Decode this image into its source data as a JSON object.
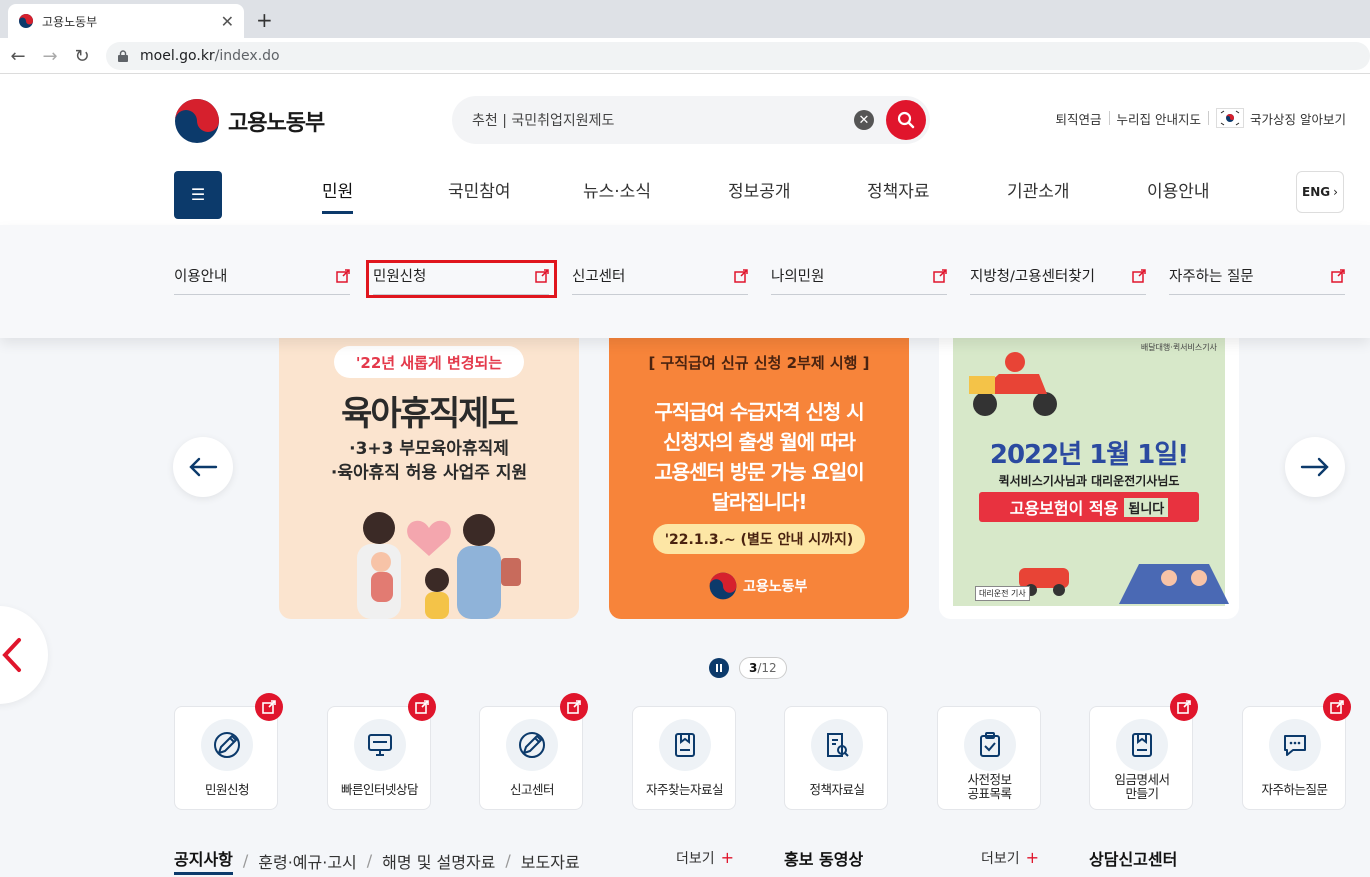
{
  "browser": {
    "tab_title": "고용노동부",
    "url_domain": "moel.go.kr",
    "url_path": "/index.do"
  },
  "header": {
    "logo_text": "고용노동부",
    "search_value": "추천 | 국민취업지원제도",
    "utils": [
      "퇴직연금",
      "누리집 안내지도",
      "국가상징 알아보기"
    ],
    "lang_label": "ENG"
  },
  "gnb": [
    "민원",
    "국민참여",
    "뉴스·소식",
    "정보공개",
    "정책자료",
    "기관소개",
    "이용안내"
  ],
  "submenu": [
    "이용안내",
    "민원신청",
    "신고센터",
    "나의민원",
    "지방청/고용센터찾기",
    "자주하는 질문"
  ],
  "carousel": {
    "card1": {
      "pill": "'22년 새롭게 변경되는",
      "title": "육아휴직제도",
      "line1": "·3+3 부모육아휴직제",
      "line2": "·육아휴직 허용 사업주 지원"
    },
    "card2": {
      "top": "[ 구직급여 신규 신청 2부제 시행 ]",
      "line1": "구직급여 수급자격 신청 시",
      "line2": "신청자의 출생 월에 따라",
      "line3": "고용센터 방문 가능 요일이",
      "line4": "달라집니다!",
      "date": "'22.1.3.~ (별도 안내 시까지)",
      "brand": "고용노동부"
    },
    "card3": {
      "tag": "배달대행·퀵서비스기사",
      "headline": "2022년 1월 1일!",
      "sub": "퀵서비스기사님과 대리운전기사님도",
      "banner": "고용보험이 적용",
      "banner_suffix": "됩니다",
      "label": "대리운전 기사"
    },
    "pager_current": "3",
    "pager_total": "/12"
  },
  "quick_links": [
    {
      "label": "민원신청",
      "badge": true
    },
    {
      "label": "빠른인터넷상담",
      "badge": true
    },
    {
      "label": "신고센터",
      "badge": true
    },
    {
      "label": "자주찾는자료실",
      "badge": false
    },
    {
      "label": "정책자료실",
      "badge": false
    },
    {
      "label": "사전정보\n공표목록",
      "badge": false
    },
    {
      "label": "임금명세서\n만들기",
      "badge": true
    },
    {
      "label": "자주하는질문",
      "badge": true
    }
  ],
  "bottom": {
    "tabs": [
      "공지사항",
      "훈령·예규·고시",
      "해명 및 설명자료",
      "보도자료"
    ],
    "more": "더보기",
    "video_title": "홍보 동영상",
    "more2": "더보기",
    "center_title": "상담신고센터"
  },
  "colors": {
    "brand_navy": "#0c3a6b",
    "accent_red": "#e0152c",
    "highlight_red": "#e0161e"
  }
}
